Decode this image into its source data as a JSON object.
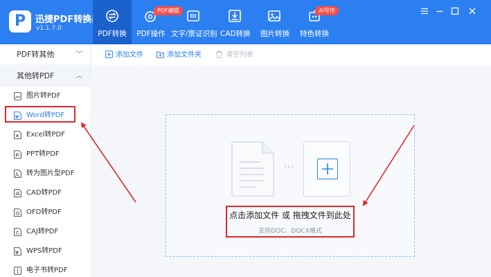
{
  "app": {
    "logo_letter": "P",
    "name": "迅捷PDF转换器",
    "version": "v1.1.7.0"
  },
  "nav": {
    "tabs": [
      {
        "label": "PDF转换",
        "icon": "convert-icon",
        "active": true
      },
      {
        "label": "PDF操作",
        "icon": "pdf-operate-icon",
        "badge": "PDF编辑"
      },
      {
        "label": "文字/票证识别",
        "icon": "ocr-scan-icon"
      },
      {
        "label": "CAD转换",
        "icon": "cad-icon"
      },
      {
        "label": "图片转换",
        "icon": "image-icon"
      },
      {
        "label": "特色转换",
        "icon": "ai-icon",
        "badge": "AI写作"
      }
    ]
  },
  "window_controls": [
    "menu-icon",
    "minimize-icon",
    "maximize-icon",
    "close-icon"
  ],
  "sidebar": {
    "groups": [
      {
        "label": "PDF转其他",
        "state": "collapsed"
      },
      {
        "label": "其他转PDF",
        "state": "expanded"
      }
    ],
    "items": [
      {
        "label": "图片转PDF"
      },
      {
        "label": "Word转PDF",
        "selected": true
      },
      {
        "label": "Excel转PDF"
      },
      {
        "label": "PPT转PDF"
      },
      {
        "label": "转为图片型PDF"
      },
      {
        "label": "CAD转PDF"
      },
      {
        "label": "OFD转PDF"
      },
      {
        "label": "CAJ转PDF"
      },
      {
        "label": "WPS转PDF"
      },
      {
        "label": "电子书转PDF"
      }
    ]
  },
  "toolbar": {
    "add_file": "添加文件",
    "add_folder": "添加文件夹",
    "clear_list": "清空列表"
  },
  "dropzone": {
    "main_text": "点击添加文件 或 拖拽文件到此处",
    "sub_text": "支持DOC、DOCX格式",
    "arrows": "›››"
  },
  "colors": {
    "brand_blue": "#2c7ff0",
    "active_tab": "#1c62cc",
    "badge_red": "#ff4d44",
    "annotation_red": "#e0262a"
  }
}
